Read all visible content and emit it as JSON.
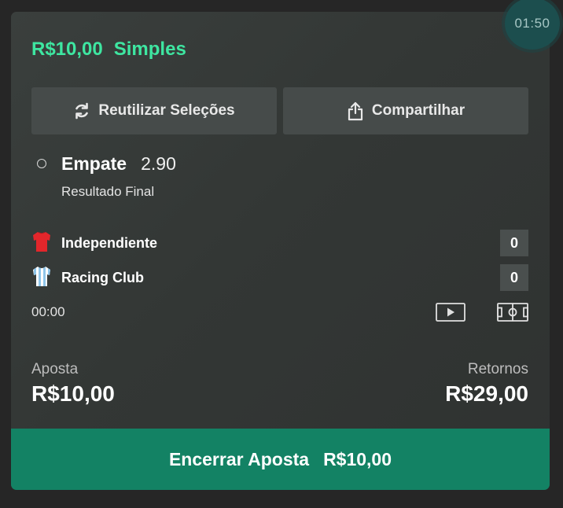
{
  "timer": "01:50",
  "bet": {
    "amount": "R$10,00",
    "type": "Simples"
  },
  "actions": {
    "reuse_label": "Reutilizar Seleções",
    "share_label": "Compartilhar"
  },
  "selection": {
    "name": "Empate",
    "odds": "2.90",
    "market": "Resultado Final"
  },
  "match": {
    "home": {
      "name": "Independiente",
      "score": "0",
      "shirt_color": "#e3262b"
    },
    "away": {
      "name": "Racing Club",
      "score": "0",
      "shirt_color": "#8fc6ea"
    },
    "clock": "00:00"
  },
  "summary": {
    "stake_label": "Aposta",
    "stake_value": "R$10,00",
    "returns_label": "Retornos",
    "returns_value": "R$29,00"
  },
  "cashout": {
    "label": "Encerrar Aposta",
    "amount": "R$10,00"
  },
  "colors": {
    "accent": "#3ee6a1",
    "cashout_bg": "#138264",
    "card_bg": "#363a39"
  }
}
